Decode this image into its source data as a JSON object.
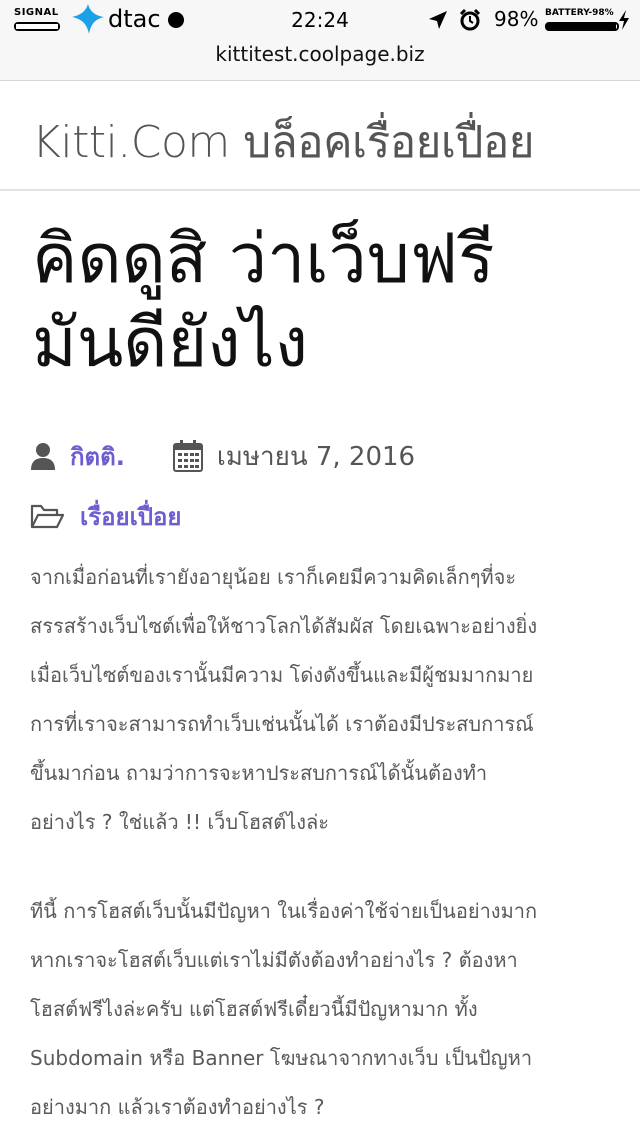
{
  "status_bar": {
    "signal_label": "SIGNAL",
    "carrier": "dtac",
    "time": "22:24",
    "battery_percent": "98%",
    "battery_label": "BATTERY-98%",
    "battery_level": 0.98,
    "icons": [
      "signal-icon",
      "dtac-logo-icon",
      "wifi-dot-icon",
      "location-arrow-icon",
      "alarm-clock-icon",
      "charging-bolt-icon"
    ]
  },
  "browser": {
    "url": "kittitest.coolpage.biz"
  },
  "site": {
    "title": "Kitti.Com บล็อคเรื่อยเปื่อย"
  },
  "post": {
    "title_lines": [
      "คิดดูสิ ว่าเว็บฟรี",
      "มันดียังไง"
    ],
    "author": "กิตติ.",
    "date": "เมษายน 7, 2016",
    "category": "เรื่อยเปื่อย",
    "paragraph1": [
      "จากเมื่อก่อนที่เรายังอายุน้อย เราก็เคยมีความคิดเล็กๆที่จะ",
      "สรรสร้างเว็บไซต์เพื่อให้ชาวโลกได้สัมผัส โดยเฉพาะอย่างยิ่ง",
      "เมื่อเว็บไซต์ของเรานั้นมีความ โด่งดังขึ้นและมีผู้ชมมากมาย",
      "การที่เราจะสามารถทำเว็บเช่นนั้นได้ เราต้องมีประสบการณ์",
      "ขึ้นมาก่อน ถามว่าการจะหาประสบการณ์ได้นั้นต้องทำ",
      "อย่างไร ? ใช่แล้ว !! เว็บโฮสต์ไงล่ะ"
    ],
    "paragraph2": [
      "ทีนี้ การโฮสต์เว็บนั้นมีปัญหา ในเรื่องค่าใช้จ่ายเป็นอย่างมาก",
      "หากเราจะโฮสต์เว็บแต่เราไม่มีตังต้องทำอย่างไร ? ต้องหา",
      "โฮสต์ฟรีไงล่ะครับ แต่โฮสต์ฟรีเดี๋ยวนี้มีปัญหามาก ทั้ง",
      "Subdomain หรือ Banner โฆษณาจากทางเว็บ เป็นปัญหา",
      "อย่างมาก แล้วเราต้องทำอย่างไร ?"
    ],
    "icons": [
      "user-icon",
      "calendar-icon",
      "folder-open-icon"
    ]
  },
  "colors": {
    "accent": "#6c5dd3",
    "text": "#5a5a5a",
    "title": "#111111",
    "carrier_logo": "#1aa1e8"
  }
}
